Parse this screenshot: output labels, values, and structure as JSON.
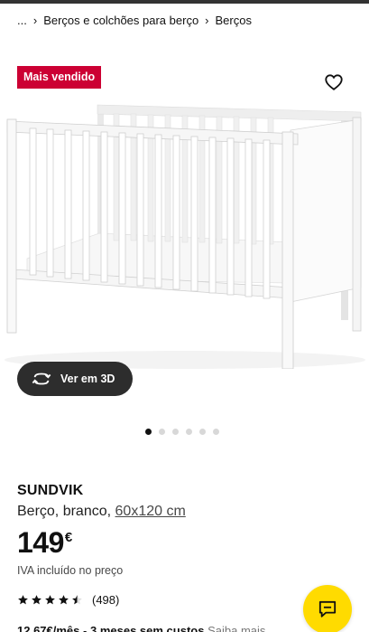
{
  "breadcrumb": {
    "ellipsis": "...",
    "items": [
      "Berços e colchões para berço",
      "Berços"
    ]
  },
  "gallery": {
    "badge": "Mais vendido",
    "favorite_icon": "heart-outline-icon",
    "view3d_label": "Ver em 3D",
    "view3d_icon": "rotate-3d-icon",
    "slide_count": 6,
    "active_slide": 1
  },
  "product": {
    "name": "SUNDVIK",
    "desc_main": "Berço, branco,",
    "desc_size": "60x120 cm",
    "price_value": "149",
    "price_currency": "€",
    "vat_note": "IVA incluído no preço",
    "rating_value": 4.5,
    "rating_max": 5,
    "rating_count": "(498)"
  },
  "financing": {
    "amount": "12,67€/mês",
    "rest": "3 meses sem custos",
    "link": "Saiba mais"
  },
  "colors": {
    "badge": "#cc0033",
    "chat_button": "#ffdb00",
    "dark_button": "#2d2d2d"
  },
  "chat": {
    "icon": "chat-icon"
  }
}
